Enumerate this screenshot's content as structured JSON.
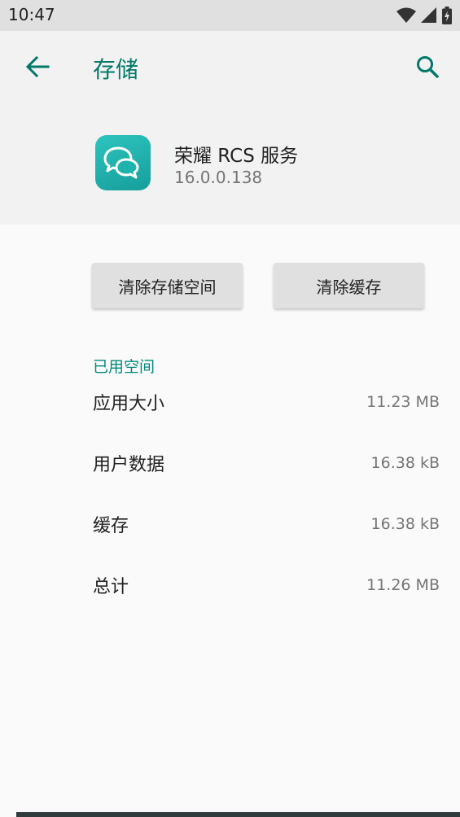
{
  "status_bar": {
    "time": "10:47"
  },
  "toolbar": {
    "title": "存储"
  },
  "app": {
    "name": "荣耀 RCS 服务",
    "version": "16.0.0.138"
  },
  "actions": {
    "clear_storage": "清除存储空间",
    "clear_cache": "清除缓存"
  },
  "storage": {
    "section_title": "已用空间",
    "rows": [
      {
        "label": "应用大小",
        "value": "11.23 MB"
      },
      {
        "label": "用户数据",
        "value": "16.38 kB"
      },
      {
        "label": "缓存",
        "value": "16.38 kB"
      },
      {
        "label": "总计",
        "value": "11.26 MB"
      }
    ]
  },
  "colors": {
    "accent": "#00796b",
    "app_icon": "#1fb3ae",
    "header_bg": "#f2f2f2"
  }
}
